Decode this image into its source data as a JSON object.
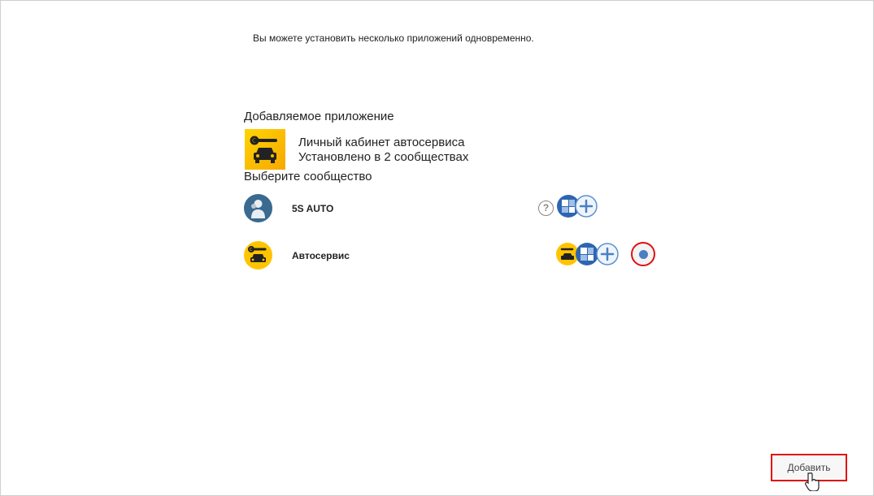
{
  "info_text": "Вы можете установить несколько приложений одновременно.",
  "app_section": {
    "title": "Добавляемое приложение",
    "app_name": "Личный кабинет автосервиса",
    "install_info": "Установлено в 2 сообществах"
  },
  "community_section": {
    "title": "Выберите сообщество",
    "communities": [
      {
        "name": "5S AUTO",
        "selected": false
      },
      {
        "name": "Автосервис",
        "selected": true
      }
    ]
  },
  "help_symbol": "?",
  "add_button_label": "Добавить",
  "colors": {
    "accent_blue": "#4a7fc1",
    "highlight_red": "#e01010",
    "app_yellow": "#ffd400"
  }
}
